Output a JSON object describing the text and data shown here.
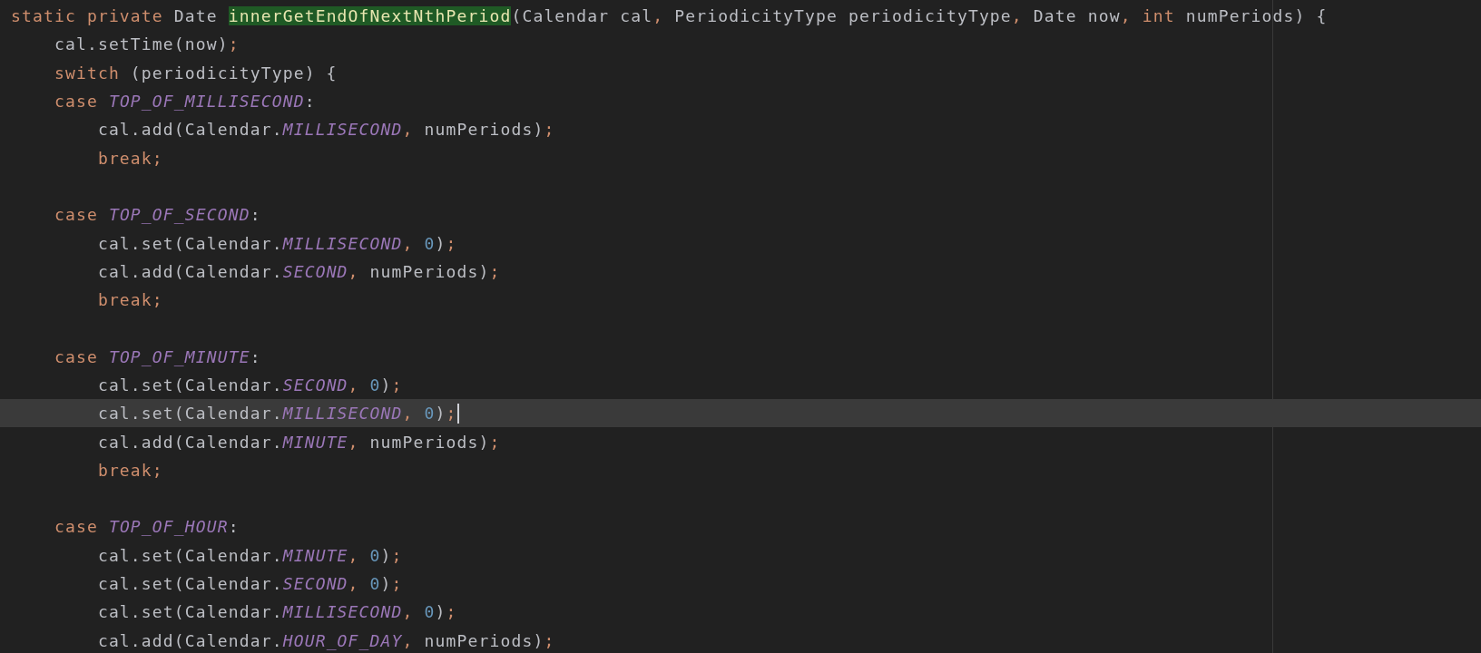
{
  "editor": {
    "lines": [
      {
        "current": false,
        "tokens": [
          {
            "kind": "kw",
            "text": "static private "
          },
          {
            "kind": "plain",
            "text": "Date "
          },
          {
            "kind": "decl",
            "text": "innerGetEndOfNextNthPeriod"
          },
          {
            "kind": "plain",
            "text": "(Calendar cal"
          },
          {
            "kind": "punct",
            "text": ", "
          },
          {
            "kind": "plain",
            "text": "PeriodicityType periodicityType"
          },
          {
            "kind": "punct",
            "text": ", "
          },
          {
            "kind": "plain",
            "text": "Date now"
          },
          {
            "kind": "punct",
            "text": ", "
          },
          {
            "kind": "kw",
            "text": "int "
          },
          {
            "kind": "plain",
            "text": "numPeriods) {"
          }
        ]
      },
      {
        "current": false,
        "tokens": [
          {
            "kind": "plain",
            "text": "    cal.setTime(now)"
          },
          {
            "kind": "punct",
            "text": ";"
          }
        ]
      },
      {
        "current": false,
        "tokens": [
          {
            "kind": "kw",
            "text": "    switch "
          },
          {
            "kind": "plain",
            "text": "(periodicityType) {"
          }
        ]
      },
      {
        "current": false,
        "tokens": [
          {
            "kind": "kw",
            "text": "    case "
          },
          {
            "kind": "const",
            "text": "TOP_OF_MILLISECOND"
          },
          {
            "kind": "plain",
            "text": ":"
          }
        ]
      },
      {
        "current": false,
        "tokens": [
          {
            "kind": "plain",
            "text": "        cal.add(Calendar."
          },
          {
            "kind": "const",
            "text": "MILLISECOND"
          },
          {
            "kind": "punct",
            "text": ", "
          },
          {
            "kind": "plain",
            "text": "numPeriods)"
          },
          {
            "kind": "punct",
            "text": ";"
          }
        ]
      },
      {
        "current": false,
        "tokens": [
          {
            "kind": "kw",
            "text": "        break;"
          }
        ]
      },
      {
        "current": false
      },
      {
        "current": false,
        "tokens": [
          {
            "kind": "kw",
            "text": "    case "
          },
          {
            "kind": "const",
            "text": "TOP_OF_SECOND"
          },
          {
            "kind": "plain",
            "text": ":"
          }
        ]
      },
      {
        "current": false,
        "tokens": [
          {
            "kind": "plain",
            "text": "        cal.set(Calendar."
          },
          {
            "kind": "const",
            "text": "MILLISECOND"
          },
          {
            "kind": "punct",
            "text": ", "
          },
          {
            "kind": "num",
            "text": "0"
          },
          {
            "kind": "plain",
            "text": ")"
          },
          {
            "kind": "punct",
            "text": ";"
          }
        ]
      },
      {
        "current": false,
        "tokens": [
          {
            "kind": "plain",
            "text": "        cal.add(Calendar."
          },
          {
            "kind": "const",
            "text": "SECOND"
          },
          {
            "kind": "punct",
            "text": ", "
          },
          {
            "kind": "plain",
            "text": "numPeriods)"
          },
          {
            "kind": "punct",
            "text": ";"
          }
        ]
      },
      {
        "current": false,
        "tokens": [
          {
            "kind": "kw",
            "text": "        break;"
          }
        ]
      },
      {
        "current": false
      },
      {
        "current": false,
        "tokens": [
          {
            "kind": "kw",
            "text": "    case "
          },
          {
            "kind": "const",
            "text": "TOP_OF_MINUTE"
          },
          {
            "kind": "plain",
            "text": ":"
          }
        ]
      },
      {
        "current": false,
        "tokens": [
          {
            "kind": "plain",
            "text": "        cal.set(Calendar."
          },
          {
            "kind": "const",
            "text": "SECOND"
          },
          {
            "kind": "punct",
            "text": ", "
          },
          {
            "kind": "num",
            "text": "0"
          },
          {
            "kind": "plain",
            "text": ")"
          },
          {
            "kind": "punct",
            "text": ";"
          }
        ]
      },
      {
        "current": true,
        "tokens": [
          {
            "kind": "plain",
            "text": "        cal.set(Calendar."
          },
          {
            "kind": "const",
            "text": "MILLISECOND"
          },
          {
            "kind": "punct",
            "text": ", "
          },
          {
            "kind": "num",
            "text": "0"
          },
          {
            "kind": "plain",
            "text": ")"
          },
          {
            "kind": "punct",
            "text": ";"
          }
        ]
      },
      {
        "current": false,
        "tokens": [
          {
            "kind": "plain",
            "text": "        cal.add(Calendar."
          },
          {
            "kind": "const",
            "text": "MINUTE"
          },
          {
            "kind": "punct",
            "text": ", "
          },
          {
            "kind": "plain",
            "text": "numPeriods)"
          },
          {
            "kind": "punct",
            "text": ";"
          }
        ]
      },
      {
        "current": false,
        "tokens": [
          {
            "kind": "kw",
            "text": "        break;"
          }
        ]
      },
      {
        "current": false
      },
      {
        "current": false,
        "tokens": [
          {
            "kind": "kw",
            "text": "    case "
          },
          {
            "kind": "const",
            "text": "TOP_OF_HOUR"
          },
          {
            "kind": "plain",
            "text": ":"
          }
        ]
      },
      {
        "current": false,
        "tokens": [
          {
            "kind": "plain",
            "text": "        cal.set(Calendar."
          },
          {
            "kind": "const",
            "text": "MINUTE"
          },
          {
            "kind": "punct",
            "text": ", "
          },
          {
            "kind": "num",
            "text": "0"
          },
          {
            "kind": "plain",
            "text": ")"
          },
          {
            "kind": "punct",
            "text": ";"
          }
        ]
      },
      {
        "current": false,
        "tokens": [
          {
            "kind": "plain",
            "text": "        cal.set(Calendar."
          },
          {
            "kind": "const",
            "text": "SECOND"
          },
          {
            "kind": "punct",
            "text": ", "
          },
          {
            "kind": "num",
            "text": "0"
          },
          {
            "kind": "plain",
            "text": ")"
          },
          {
            "kind": "punct",
            "text": ";"
          }
        ]
      },
      {
        "current": false,
        "tokens": [
          {
            "kind": "plain",
            "text": "        cal.set(Calendar."
          },
          {
            "kind": "const",
            "text": "MILLISECOND"
          },
          {
            "kind": "punct",
            "text": ", "
          },
          {
            "kind": "num",
            "text": "0"
          },
          {
            "kind": "plain",
            "text": ")"
          },
          {
            "kind": "punct",
            "text": ";"
          }
        ]
      },
      {
        "current": false,
        "tokens": [
          {
            "kind": "plain",
            "text": "        cal.add(Calendar."
          },
          {
            "kind": "const",
            "text": "HOUR_OF_DAY"
          },
          {
            "kind": "punct",
            "text": ", "
          },
          {
            "kind": "plain",
            "text": "numPeriods)"
          },
          {
            "kind": "punct",
            "text": ";"
          }
        ]
      }
    ]
  }
}
